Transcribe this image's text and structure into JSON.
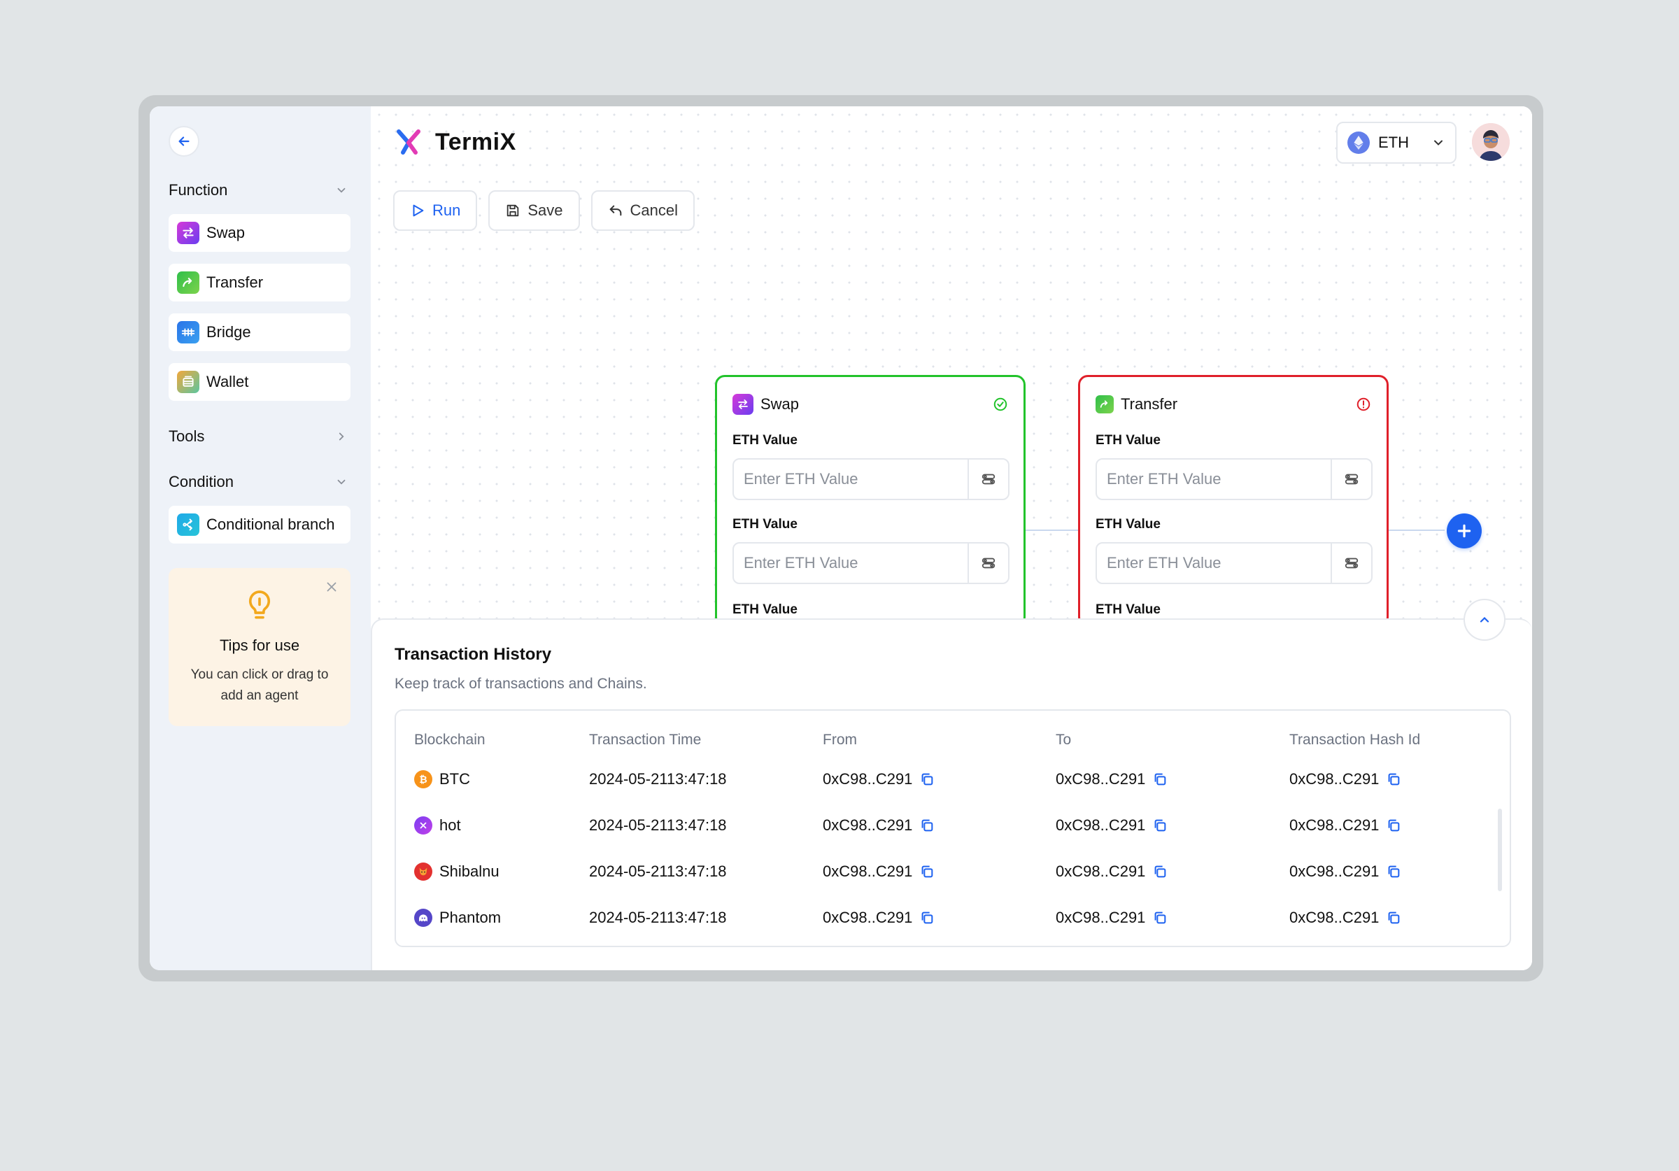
{
  "app": {
    "name": "TermiX"
  },
  "header": {
    "network": "ETH"
  },
  "toolbar": {
    "run": "Run",
    "save": "Save",
    "cancel": "Cancel"
  },
  "sidebar": {
    "function_title": "Function",
    "functions": [
      {
        "label": "Swap",
        "icon": "swap-icon"
      },
      {
        "label": "Transfer",
        "icon": "transfer-icon"
      },
      {
        "label": "Bridge",
        "icon": "bridge-icon"
      },
      {
        "label": "Wallet",
        "icon": "wallet-icon"
      }
    ],
    "tools_title": "Tools",
    "condition_title": "Condition",
    "conditions": [
      {
        "label": "Conditional branch",
        "icon": "branch-icon"
      }
    ],
    "tips": {
      "title": "Tips for use",
      "text": "You can click or drag to add an agent"
    }
  },
  "nodes": [
    {
      "title": "Swap",
      "status": "success",
      "fields": [
        {
          "label": "ETH Value",
          "placeholder": "Enter ETH Value"
        },
        {
          "label": "ETH Value",
          "placeholder": "Enter ETH Value"
        },
        {
          "label": "ETH Value"
        }
      ]
    },
    {
      "title": "Transfer",
      "status": "error",
      "fields": [
        {
          "label": "ETH Value",
          "placeholder": "Enter ETH Value"
        },
        {
          "label": "ETH Value",
          "placeholder": "Enter ETH Value"
        },
        {
          "label": "ETH Value"
        }
      ]
    }
  ],
  "transactions": {
    "title": "Transaction History",
    "subtitle": "Keep track of transactions and Chains.",
    "columns": [
      "Blockchain",
      "Transaction Time",
      "From",
      "To",
      "Transaction Hash Id"
    ],
    "rows": [
      {
        "chain": "BTC",
        "time": "2024-05-2113:47:18",
        "from": "0xC98..C291",
        "to": "0xC98..C291",
        "hash": "0xC98..C291"
      },
      {
        "chain": "hot",
        "time": "2024-05-2113:47:18",
        "from": "0xC98..C291",
        "to": "0xC98..C291",
        "hash": "0xC98..C291"
      },
      {
        "chain": "Shibalnu",
        "time": "2024-05-2113:47:18",
        "from": "0xC98..C291",
        "to": "0xC98..C291",
        "hash": "0xC98..C291"
      },
      {
        "chain": "Phantom",
        "time": "2024-05-2113:47:18",
        "from": "0xC98..C291",
        "to": "0xC98..C291",
        "hash": "0xC98..C291"
      }
    ]
  },
  "colors": {
    "accent": "#1e62f0",
    "success": "#22c32b",
    "error": "#e0202a",
    "tips_bg": "#fdf3e5"
  }
}
